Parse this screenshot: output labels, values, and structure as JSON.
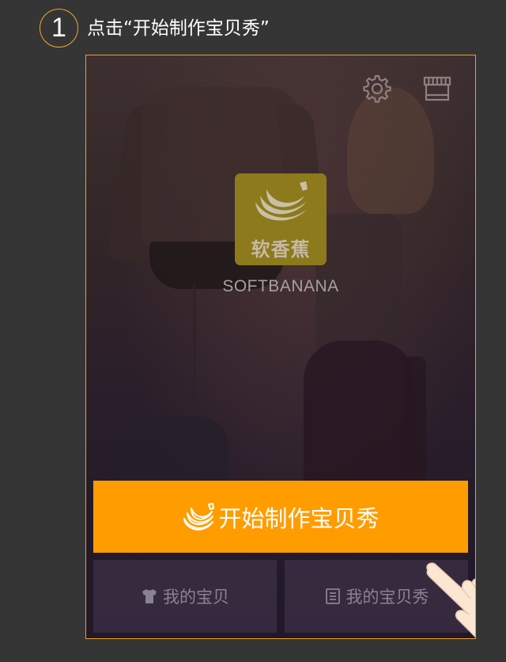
{
  "step": {
    "number": "1",
    "instruction": "点击“开始制作宝贝秀”"
  },
  "app": {
    "logo_text": "软香蕉",
    "brand_name": "SOFTBANANA",
    "icons": {
      "settings": "gear-icon",
      "store": "store-icon",
      "banana": "banana-icon",
      "shirt": "shirt-icon",
      "list": "document-list-icon",
      "hand": "hand-pointer-icon"
    },
    "start_button_label": "开始制作宝贝秀",
    "bottom_buttons": [
      {
        "label": "我的宝贝"
      },
      {
        "label": "我的宝贝秀"
      }
    ]
  },
  "colors": {
    "background": "#353535",
    "accent": "#ff9c00",
    "frame_border": "#f0a020",
    "step_badge_border": "#f5a623",
    "logo_bg": "#8c7a1c"
  }
}
